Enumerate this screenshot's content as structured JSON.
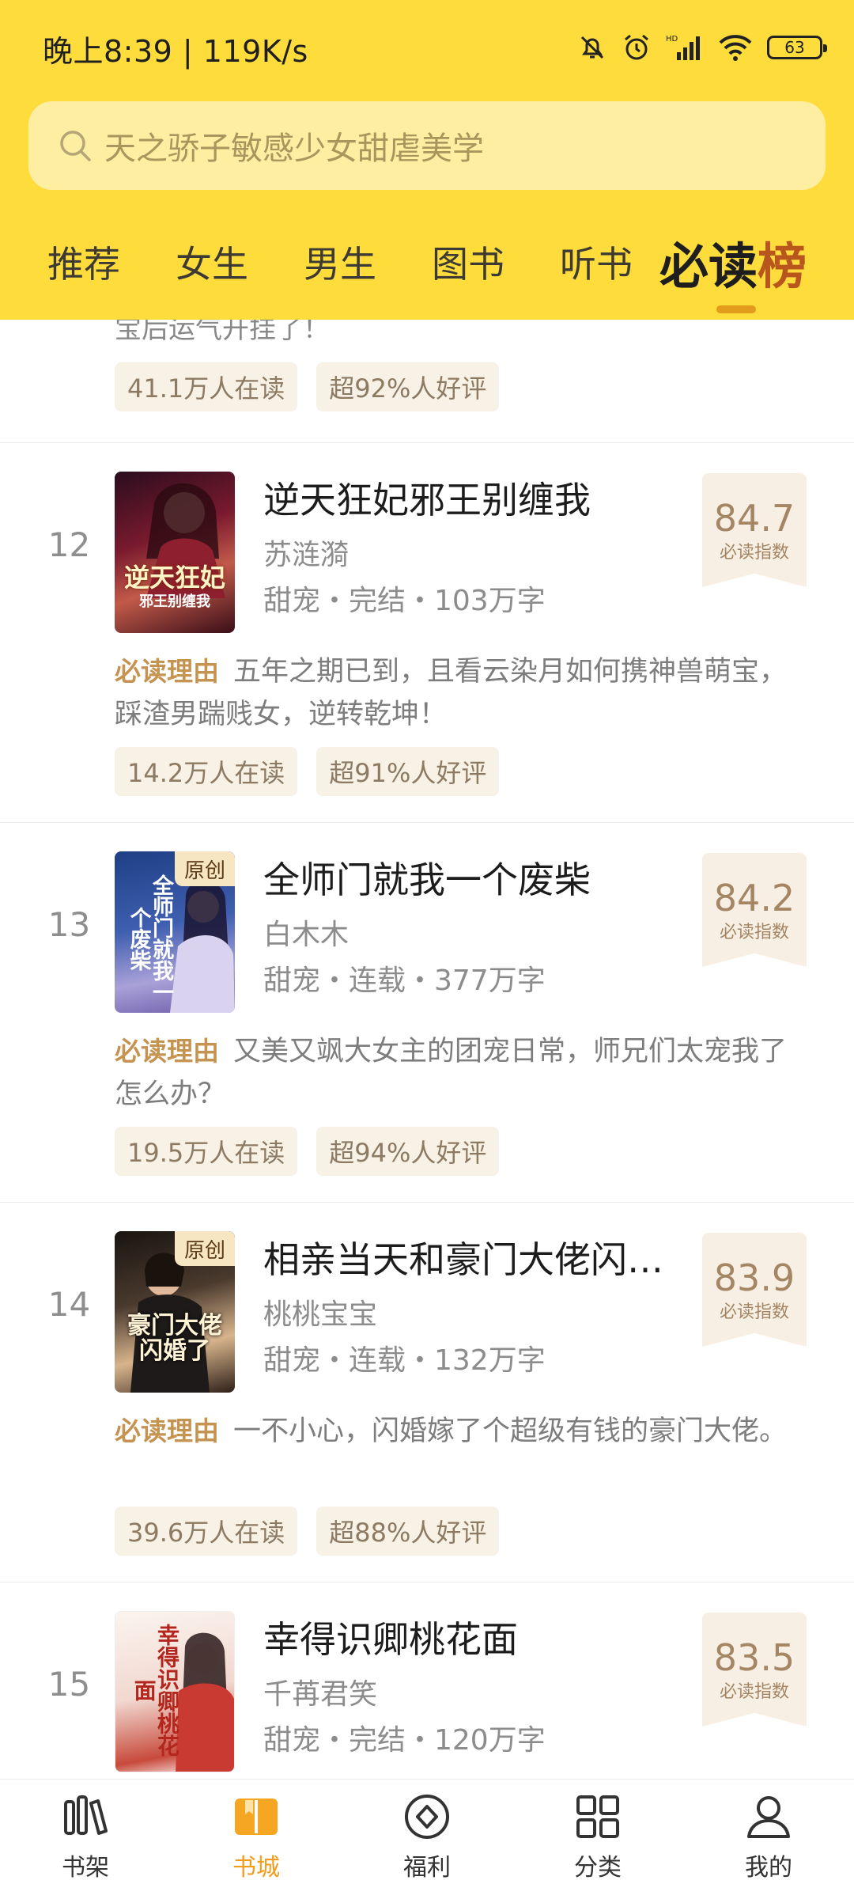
{
  "status_bar": {
    "time": "晚上8:39 | 119K/s",
    "battery": "63"
  },
  "search": {
    "placeholder": "天之骄子敏感少女甜虐美学"
  },
  "tabs": [
    {
      "label": "推荐"
    },
    {
      "label": "女生"
    },
    {
      "label": "男生"
    },
    {
      "label": "图书"
    },
    {
      "label": "听书"
    },
    {
      "label_a": "必读",
      "label_b": "榜",
      "active": true
    }
  ],
  "partial_item": {
    "desc_tail": "宝后运气开挂了！",
    "tags": [
      "41.1万人在读",
      "超92%人好评"
    ]
  },
  "books": [
    {
      "rank": "12",
      "cover_text": "逆天狂妃",
      "cover_sub": "邪王别缠我",
      "title": "逆天狂妃邪王别缠我",
      "author": "苏涟漪",
      "meta": "甜宠・完结・103万字",
      "score": "84.7",
      "score_label": "必读指数",
      "reason_badge": "必读理由",
      "reason": "五年之期已到，且看云染月如何携神兽萌宝，踩渣男踹贱女，逆转乾坤！",
      "tags": [
        "14.2万人在读",
        "超91%人好评"
      ]
    },
    {
      "rank": "13",
      "badge": "原创",
      "cover_text": "全师门就我一个废柴",
      "cover_sub": "白木木",
      "title": "全师门就我一个废柴",
      "author": "白木木",
      "meta": "甜宠・连载・377万字",
      "score": "84.2",
      "score_label": "必读指数",
      "reason_badge": "必读理由",
      "reason": "又美又飒大女主的团宠日常，师兄们太宠我了怎么办？",
      "tags": [
        "19.5万人在读",
        "超94%人好评"
      ]
    },
    {
      "rank": "14",
      "badge": "原创",
      "cover_text": "豪门大佬闪婚了",
      "cover_sub": "",
      "title": "相亲当天和豪门大佬闪…",
      "author": "桃桃宝宝",
      "meta": "甜宠・连载・132万字",
      "score": "83.9",
      "score_label": "必读指数",
      "reason_badge": "必读理由",
      "reason": "一不小心，闪婚嫁了个超级有钱的豪门大佬。",
      "tags": [
        "39.6万人在读",
        "超88%人好评"
      ]
    },
    {
      "rank": "15",
      "cover_text": "幸得识卿桃花面",
      "cover_sub": "千苒君笑",
      "title": "幸得识卿桃花面",
      "author": "千苒君笑",
      "meta": "甜宠・完结・120万字",
      "score": "83.5",
      "score_label": "必读指数"
    }
  ],
  "bottom_nav": [
    {
      "label": "书架",
      "icon": "bookshelf-icon"
    },
    {
      "label": "书城",
      "icon": "bookstore-icon",
      "active": true
    },
    {
      "label": "福利",
      "icon": "welfare-icon"
    },
    {
      "label": "分类",
      "icon": "category-icon"
    },
    {
      "label": "我的",
      "icon": "profile-icon"
    }
  ],
  "colors": {
    "header": "#fedc3c",
    "accent": "#f39b1a",
    "score_bg": "#f7efe3",
    "tag_bg": "#f8f1e6"
  }
}
